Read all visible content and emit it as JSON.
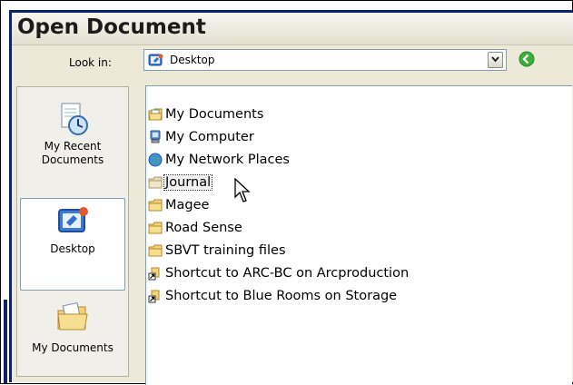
{
  "dialog": {
    "title": "Open Document",
    "look_in_label": "Look in:",
    "look_in_value": "Desktop"
  },
  "places": [
    {
      "label": "My Recent Documents",
      "icon": "recent-documents-icon"
    },
    {
      "label": "Desktop",
      "icon": "desktop-icon",
      "selected": true
    },
    {
      "label": "My Documents",
      "icon": "my-documents-icon"
    }
  ],
  "files": [
    {
      "name": "My Documents",
      "icon": "my-documents-folder-icon"
    },
    {
      "name": "My Computer",
      "icon": "my-computer-icon"
    },
    {
      "name": "My Network Places",
      "icon": "network-places-icon"
    },
    {
      "name": "Journal",
      "icon": "folder-icon",
      "focused": true
    },
    {
      "name": "Magee",
      "icon": "folder-icon"
    },
    {
      "name": "Road Sense",
      "icon": "folder-icon"
    },
    {
      "name": "SBVT training files",
      "icon": "folder-icon"
    },
    {
      "name": "Shortcut to ARC-BC on Arcproduction",
      "icon": "shortcut-icon"
    },
    {
      "name": "Shortcut to Blue Rooms on Storage",
      "icon": "shortcut-icon"
    }
  ],
  "colors": {
    "accent_blue": "#0a246a",
    "folder_yellow": "#f3d27a",
    "back_green": "#3cae3a"
  }
}
